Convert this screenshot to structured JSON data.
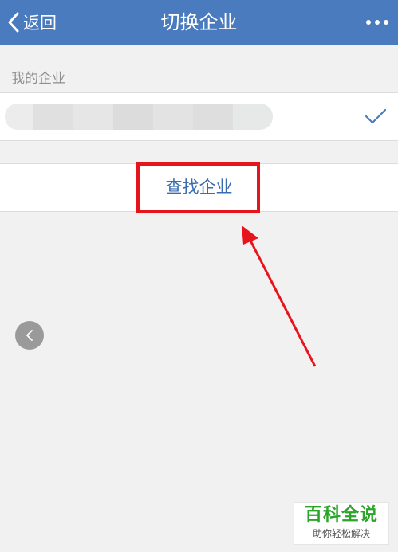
{
  "nav": {
    "back_label": "返回",
    "title": "切换企业",
    "bar_color": "#4b7bbf"
  },
  "section": {
    "my_companies_label": "我的企业"
  },
  "company": {
    "name_state": "blurred",
    "selected": true
  },
  "actions": {
    "find_company_label": "查找企业"
  },
  "annotation": {
    "box_color": "#e8141b",
    "arrow_color": "#e8141b"
  },
  "watermark": {
    "title": "百科全说",
    "subtitle": "助你轻松解决"
  },
  "icons": {
    "back": "chevron-left-icon",
    "more": "more-dots-icon",
    "check": "checkmark-icon",
    "float_back": "chevron-left-icon"
  }
}
